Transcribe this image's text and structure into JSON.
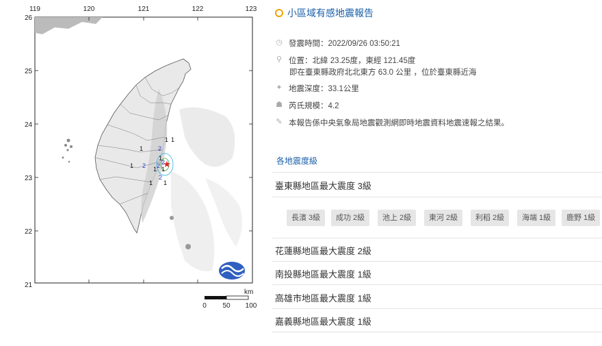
{
  "map": {
    "lat_ticks": [
      "26",
      "25",
      "24",
      "23",
      "22",
      "21"
    ],
    "lon_ticks": [
      "119",
      "120",
      "121",
      "122",
      "123"
    ],
    "scale_unit": "km",
    "scale_labels": [
      "0",
      "50",
      "100"
    ],
    "stations": [
      {
        "v": "1",
        "c": "#111"
      },
      {
        "v": "1",
        "c": "#111"
      },
      {
        "v": "1",
        "c": "#111"
      },
      {
        "v": "2",
        "c": "#2b3cc9"
      },
      {
        "v": "1",
        "c": "#111"
      },
      {
        "v": "2",
        "c": "#2b3cc9"
      },
      {
        "v": "2",
        "c": "#2b3cc9"
      },
      {
        "v": "2",
        "c": "#2b3cc9"
      },
      {
        "v": "1",
        "c": "#111"
      },
      {
        "v": "1",
        "c": "#111"
      },
      {
        "v": "1",
        "c": "#111"
      },
      {
        "v": "2",
        "c": "#2b3cc9"
      },
      {
        "v": "1",
        "c": "#111"
      },
      {
        "v": "1",
        "c": "#111"
      }
    ]
  },
  "report": {
    "title": "小區域有感地震報告",
    "time_label": "發震時間：2022/09/26 03:50:21",
    "location_label": "位置：北緯 23.25度，東經 121.45度",
    "location_detail": "即在臺東縣政府北北東方 63.0 公里 ，位於臺東縣近海",
    "depth_label": "地震深度：33.1公里",
    "magnitude_label": "芮氏規模：4.2",
    "note": "本報告係中央氣象局地震觀測網即時地震資料地震速報之結果。"
  },
  "intensity": {
    "section_title": "各地震度級",
    "counties": [
      "臺東縣地區最大震度 3級",
      "花蓮縣地區最大震度 2級",
      "南投縣地區最大震度 1級",
      "高雄市地區最大震度 1級",
      "嘉義縣地區最大震度 1級"
    ],
    "stations": [
      "長濱 3級",
      "成功 2級",
      "池上 2級",
      "東河 2級",
      "利稻 2級",
      "海端 1級",
      "鹿野 1級"
    ]
  }
}
